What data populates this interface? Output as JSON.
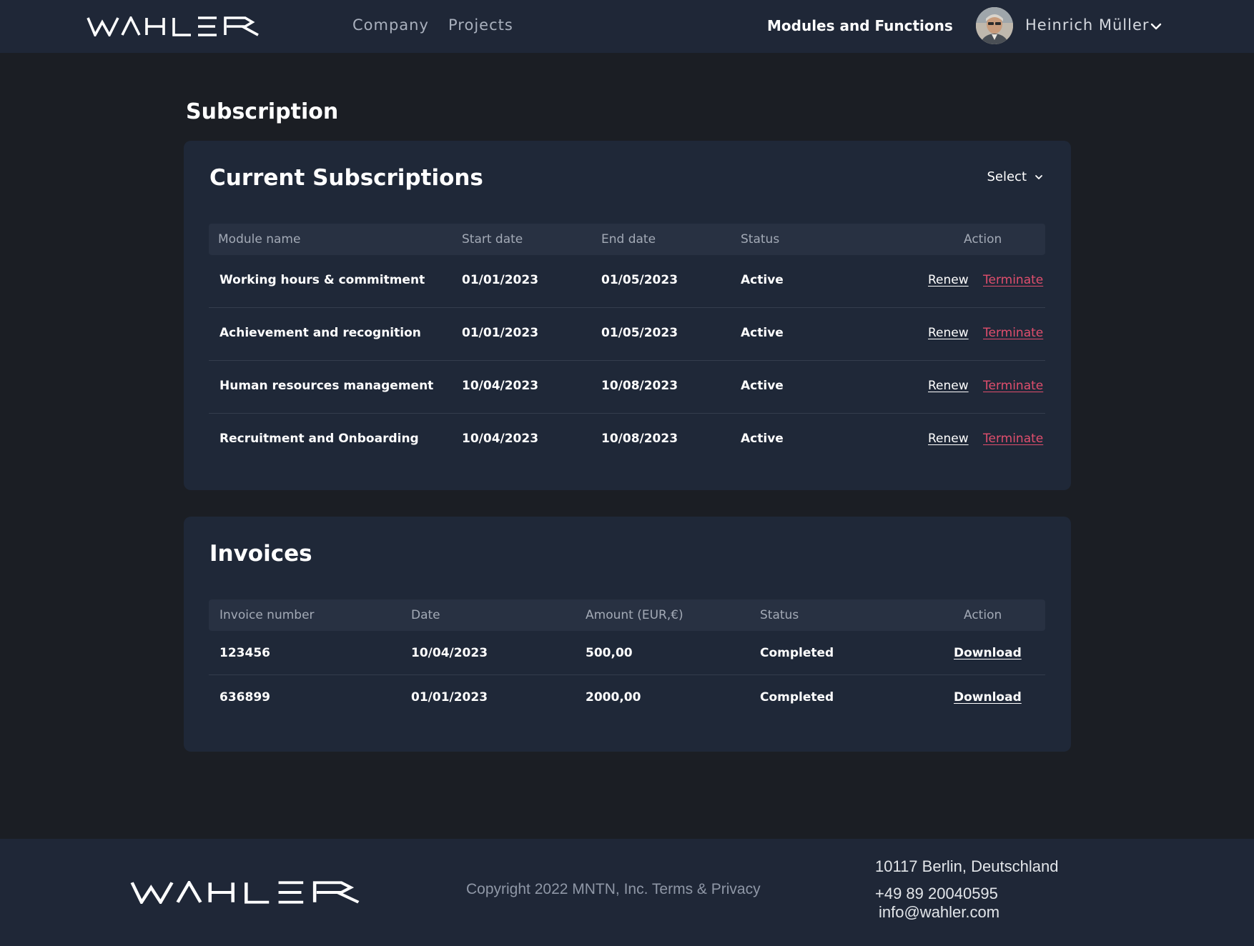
{
  "brand": {
    "logo_text": "WAHLER"
  },
  "nav": {
    "company": "Company",
    "projects": "Projects",
    "modules": "Modules and Functions",
    "user_name": "Heinrich Müller"
  },
  "page": {
    "title": "Subscription"
  },
  "subscriptions": {
    "title": "Current Subscriptions",
    "select_label": "Select",
    "headers": {
      "module": "Module name",
      "start": "Start date",
      "end": "End date",
      "status": "Status",
      "action": "Action"
    },
    "rows": [
      {
        "module": "Working hours & commitment",
        "start": "01/01/2023",
        "end": "01/05/2023",
        "status": "Active",
        "renew": "Renew",
        "terminate": "Terminate"
      },
      {
        "module": "Achievement and recognition",
        "start": "01/01/2023",
        "end": "01/05/2023",
        "status": "Active",
        "renew": "Renew",
        "terminate": "Terminate"
      },
      {
        "module": "Human resources management",
        "start": "10/04/2023",
        "end": "10/08/2023",
        "status": "Active",
        "renew": "Renew",
        "terminate": "Terminate"
      },
      {
        "module": "Recruitment and Onboarding",
        "start": "10/04/2023",
        "end": "10/08/2023",
        "status": "Active",
        "renew": "Renew",
        "terminate": "Terminate"
      }
    ]
  },
  "invoices": {
    "title": "Invoices",
    "headers": {
      "number": "Invoice number",
      "date": "Date",
      "amount": "Amount (EUR,€)",
      "status": "Status",
      "action": "Action"
    },
    "rows": [
      {
        "number": "123456",
        "date": "10/04/2023",
        "amount": "500,00",
        "status": "Completed",
        "action": "Download"
      },
      {
        "number": "636899",
        "date": "01/01/2023",
        "amount": "2000,00",
        "status": "Completed",
        "action": "Download"
      }
    ]
  },
  "footer": {
    "copyright": "Copyright 2022 MNTN, Inc.",
    "terms": "Terms & Privacy",
    "address": "10117 Berlin, Deutschland",
    "phone": "+49 89 20040595",
    "email": "info@wahler.com"
  },
  "colors": {
    "page_bg": "#1b1e24",
    "header_bg": "#1f2737",
    "card_bg": "#1f2838",
    "table_head_bg": "#283142",
    "terminate": "#e04e6d"
  },
  "icons": {
    "user_menu": "chevron-down-icon",
    "select": "chevron-down-icon",
    "avatar": "user-avatar"
  }
}
